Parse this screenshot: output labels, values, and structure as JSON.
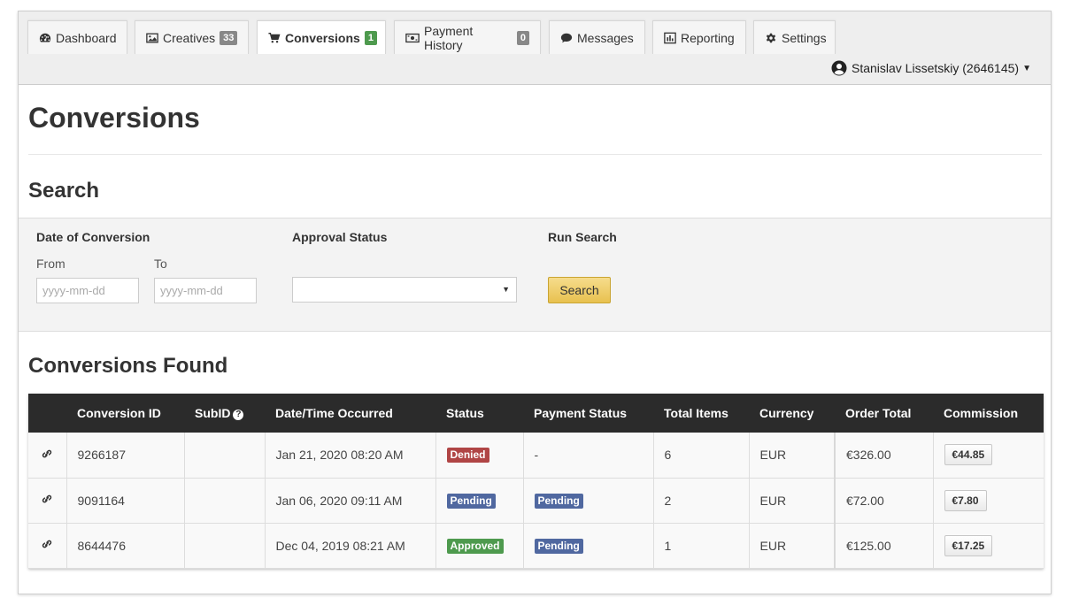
{
  "nav": {
    "tabs": [
      {
        "label": "Dashboard",
        "icon": "dashboard-icon"
      },
      {
        "label": "Creatives",
        "icon": "image-icon",
        "badge": "33"
      },
      {
        "label": "Conversions",
        "icon": "cart-icon",
        "badge": "1",
        "active": true
      },
      {
        "label": "Payment History",
        "icon": "money-icon",
        "badge": "0"
      },
      {
        "label": "Messages",
        "icon": "comment-icon"
      },
      {
        "label": "Reporting",
        "icon": "bar-chart-icon"
      },
      {
        "label": "Settings",
        "icon": "gear-icon"
      }
    ],
    "user": "Stanislav Lissetskiy (2646145)"
  },
  "page": {
    "title": "Conversions",
    "search_heading": "Search",
    "results_heading": "Conversions Found"
  },
  "search": {
    "date_label": "Date of Conversion",
    "from_label": "From",
    "to_label": "To",
    "date_placeholder": "yyyy-mm-dd",
    "approval_label": "Approval Status",
    "approval_value": "",
    "run_label": "Run Search",
    "button_label": "Search"
  },
  "table": {
    "headers": [
      "",
      "Conversion ID",
      "SubID",
      "Date/Time Occurred",
      "Status",
      "Payment Status",
      "Total Items",
      "Currency",
      "Order Total",
      "Commission"
    ],
    "rows": [
      {
        "id": "9266187",
        "subid": "",
        "date": "Jan 21, 2020 08:20 AM",
        "status": "Denied",
        "payment": "-",
        "items": "6",
        "currency": "EUR",
        "total": "€326.00",
        "commission": "€44.85"
      },
      {
        "id": "9091164",
        "subid": "",
        "date": "Jan 06, 2020 09:11 AM",
        "status": "Pending",
        "payment": "Pending",
        "items": "2",
        "currency": "EUR",
        "total": "€72.00",
        "commission": "€7.80"
      },
      {
        "id": "8644476",
        "subid": "",
        "date": "Dec 04, 2019 08:21 AM",
        "status": "Approved",
        "payment": "Pending",
        "items": "1",
        "currency": "EUR",
        "total": "€125.00",
        "commission": "€17.25"
      }
    ]
  },
  "colors": {
    "denied": "#b04545",
    "pending": "#5068a0",
    "approved": "#4e9a4e",
    "header_bg": "#2b2b2b",
    "button_gold": "#e8c14f"
  }
}
